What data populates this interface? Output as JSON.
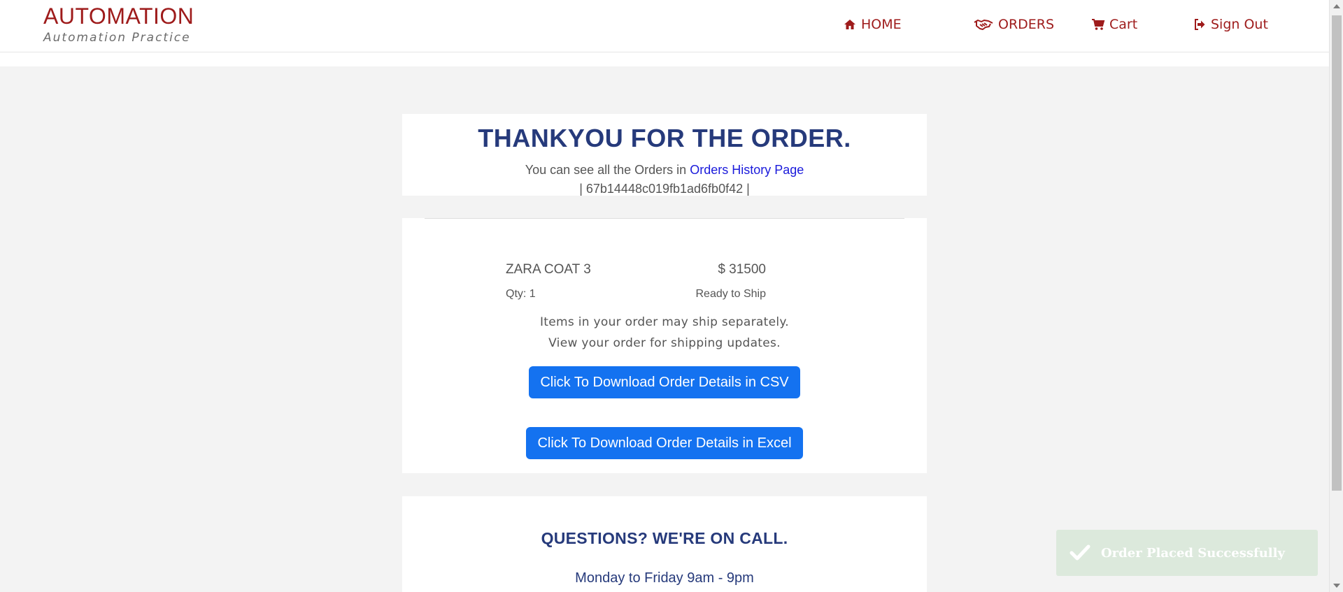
{
  "brand": {
    "title": "AUTOMATION",
    "subtitle": "Automation Practice"
  },
  "nav": {
    "home": "HOME",
    "orders": "ORDERS",
    "cart": "Cart",
    "signout": "Sign Out"
  },
  "confirmation": {
    "title": "THANKYOU FOR THE ORDER.",
    "history_prefix": "You can see all the Orders in",
    "history_link": "Orders History Page",
    "order_id": "| 67b14448c019fb1ad6fb0f42 |"
  },
  "item": {
    "name": "ZARA COAT 3",
    "price": "$ 31500",
    "qty": "Qty: 1",
    "status": "Ready to Ship"
  },
  "shipping_note": {
    "line1": "Items in your order may ship separately.",
    "line2": "View your order for shipping updates."
  },
  "buttons": {
    "csv": "Click To Download Order Details in CSV",
    "excel": "Click To Download Order Details in Excel"
  },
  "questions": {
    "title": "QUESTIONS? WE'RE ON CALL.",
    "hours": "Monday to Friday 9am - 9pm"
  },
  "toast": {
    "message": "Order Placed Successfully"
  },
  "colors": {
    "brand": "#9e1b1b",
    "heading": "#263a7b",
    "button": "#1472f0",
    "link": "#1a1adb",
    "toast_bg": "#dce9dc"
  },
  "icons": {
    "home": "home-icon",
    "orders": "handshake-icon",
    "cart": "cart-icon",
    "signout": "sign-out-icon",
    "toast": "check-icon"
  }
}
